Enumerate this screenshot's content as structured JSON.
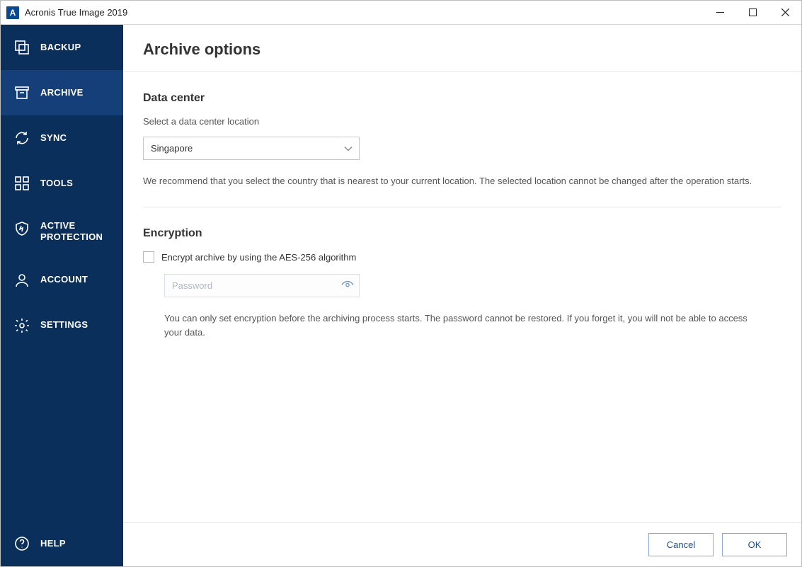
{
  "titlebar": {
    "app_logo_letter": "A",
    "title": "Acronis True Image 2019"
  },
  "sidebar": {
    "items": [
      {
        "label": "BACKUP",
        "icon": "backup"
      },
      {
        "label": "ARCHIVE",
        "icon": "archive",
        "active": true
      },
      {
        "label": "SYNC",
        "icon": "sync"
      },
      {
        "label": "TOOLS",
        "icon": "tools"
      },
      {
        "label": "ACTIVE\nPROTECTION",
        "icon": "shield"
      },
      {
        "label": "ACCOUNT",
        "icon": "account"
      },
      {
        "label": "SETTINGS",
        "icon": "settings"
      }
    ],
    "help_label": "HELP"
  },
  "main": {
    "page_title": "Archive options",
    "datacenter": {
      "section_title": "Data center",
      "field_label": "Select a data center location",
      "selected_value": "Singapore",
      "hint": "We recommend that you select the country that is nearest to your current location. The selected location cannot be changed after the operation starts."
    },
    "encryption": {
      "section_title": "Encryption",
      "checkbox_label": "Encrypt archive by using the AES-256 algorithm",
      "checkbox_checked": false,
      "password_placeholder": "Password",
      "hint": "You can only set encryption before the archiving process starts. The password cannot be restored. If you forget it, you will not be able to access your data."
    }
  },
  "footer": {
    "cancel": "Cancel",
    "ok": "OK"
  }
}
